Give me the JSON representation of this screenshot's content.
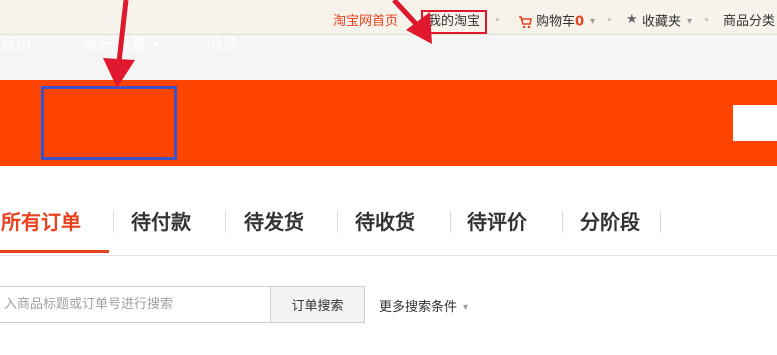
{
  "topbar": {
    "home_link": "淘宝网首页",
    "my_taobao": "我的淘宝",
    "cart_label": "购物车",
    "cart_count": "0",
    "favorites": "收藏夹",
    "categories": "商品分类"
  },
  "navbar": {
    "home": "首页",
    "account_settings": "账户设置",
    "messages": "消息"
  },
  "tabs": [
    {
      "label": "所有订单",
      "active": true
    },
    {
      "label": "待付款"
    },
    {
      "label": "待发货"
    },
    {
      "label": "待收货"
    },
    {
      "label": "待评价"
    },
    {
      "label": "分阶段"
    }
  ],
  "search": {
    "placeholder": "入商品标题或订单号进行搜索",
    "button": "订单搜索",
    "more": "更多搜索条件"
  },
  "colors": {
    "accent": "#ff4400",
    "highlight_red": "#e0182d",
    "highlight_blue": "#3b53c8"
  }
}
